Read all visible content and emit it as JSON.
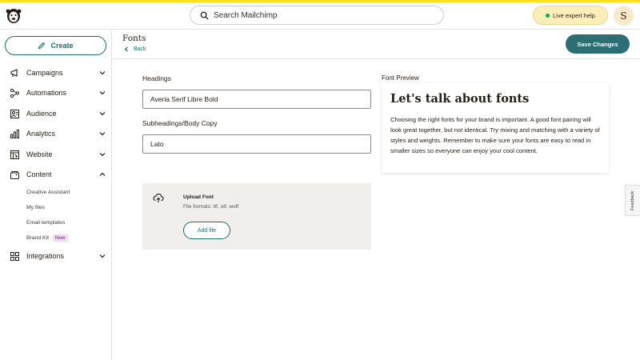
{
  "topbar": {
    "search_placeholder": "Search Mailchimp",
    "expert_help": "Live expert help",
    "avatar_initial": "S"
  },
  "sidebar": {
    "create_label": "Create",
    "items": [
      {
        "label": "Campaigns",
        "icon": "megaphone-icon",
        "expanded": false
      },
      {
        "label": "Automations",
        "icon": "automation-icon",
        "expanded": false
      },
      {
        "label": "Audience",
        "icon": "audience-icon",
        "expanded": false
      },
      {
        "label": "Analytics",
        "icon": "bar-chart-icon",
        "expanded": false
      },
      {
        "label": "Website",
        "icon": "website-icon",
        "expanded": false
      },
      {
        "label": "Content",
        "icon": "content-icon",
        "expanded": true
      },
      {
        "label": "Integrations",
        "icon": "grid-icon",
        "expanded": false
      }
    ],
    "content_subitems": [
      {
        "label": "Creative Assistant"
      },
      {
        "label": "My files"
      },
      {
        "label": "Email templates"
      },
      {
        "label": "Brand Kit",
        "badge": "New"
      }
    ]
  },
  "header": {
    "title": "Fonts",
    "back_label": "Back",
    "save_label": "Save Changes"
  },
  "form": {
    "headings_label": "Headings",
    "headings_value": "Averia Serif Libre Bold",
    "body_label": "Subheadings/Body Copy",
    "body_value": "Lato"
  },
  "upload": {
    "title": "Upload Font",
    "formats": "File formats: ttf, otf, woff",
    "button_label": "Add file"
  },
  "preview": {
    "label": "Font Preview",
    "heading": "Let's talk about fonts",
    "body": "Choosing the right fonts for your brand is important. A good font pairing will look great together, but not identical. Try mixing and matching with a variety of styles and weights. Remember to make sure your fonts are easy to read in smaller sizes so everyone can enjoy your cool content."
  },
  "feedback_label": "Feedback",
  "colors": {
    "brand_yellow": "#ffe01b",
    "primary_teal": "#2c6e74",
    "link_teal": "#1b6e6b",
    "new_badge_bg": "#f3dcf0"
  }
}
